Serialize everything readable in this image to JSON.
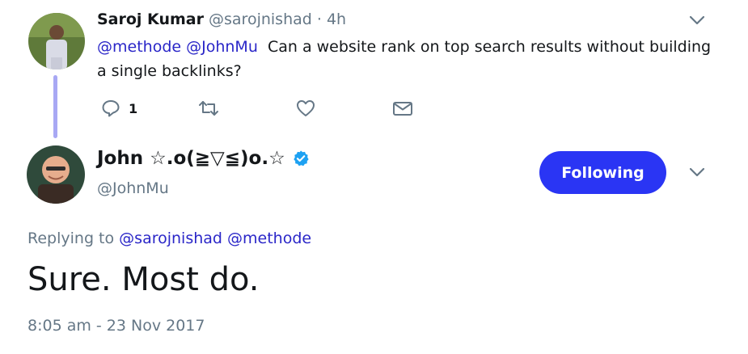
{
  "tweet1": {
    "author_name": "Saroj Kumar",
    "author_handle": "@sarojnishad",
    "separator": "·",
    "time": "4h",
    "mentions": [
      "@methode",
      "@JohnMu"
    ],
    "text": "Can a website rank on top search results without building a single backlinks?",
    "actions": {
      "reply_count": "1",
      "icons": [
        "reply-icon",
        "retweet-icon",
        "like-icon",
        "direct-message-icon"
      ]
    }
  },
  "tweet2": {
    "author_name": "John ☆.o(≧▽≦)o.☆",
    "author_handle": "@JohnMu",
    "verified": true,
    "follow_button_label": "Following",
    "replying_prefix": "Replying to",
    "replying_mentions": [
      "@sarojnishad",
      "@methode"
    ],
    "text": "Sure. Most do.",
    "timestamp": "8:05 am - 23 Nov 2017"
  },
  "colors": {
    "accent": "#2a35f4",
    "mention": "#2a26c8",
    "muted": "#657786",
    "thread_line": "#a8a8f4",
    "verified": "#1da1f2"
  }
}
